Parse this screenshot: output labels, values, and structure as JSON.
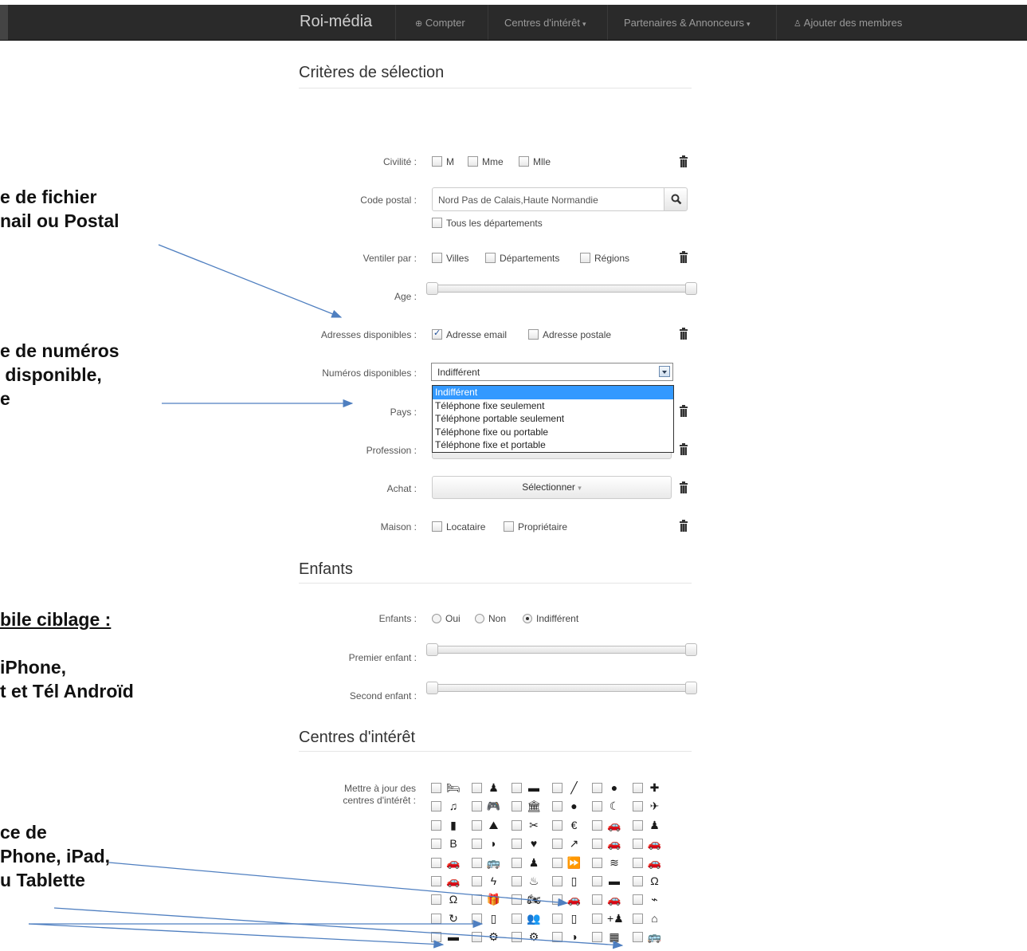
{
  "navbar": {
    "brand": "Roi-média",
    "items": [
      "Compter",
      "Centres d'intérêt",
      "Partenaires & Annonceurs",
      "Ajouter des membres"
    ]
  },
  "sections": {
    "criteria": "Critères de sélection",
    "children": "Enfants",
    "interests": "Centres d'intérêt"
  },
  "form": {
    "civilite": {
      "label": "Civilité :",
      "options": [
        "M",
        "Mme",
        "Mlle"
      ]
    },
    "code_postal": {
      "label": "Code postal :",
      "value": "Nord Pas de Calais,Haute Normandie",
      "all_label": "Tous les départements"
    },
    "ventiler": {
      "label": "Ventiler par :",
      "options": [
        "Villes",
        "Départements",
        "Régions"
      ]
    },
    "age": {
      "label": "Age :"
    },
    "adresses": {
      "label": "Adresses disponibles :",
      "options": [
        "Adresse email",
        "Adresse postale"
      ],
      "checked": [
        true,
        false
      ]
    },
    "numeros": {
      "label": "Numéros disponibles :",
      "value": "Indifférent",
      "options": [
        "Indifférent",
        "Téléphone fixe seulement",
        "Téléphone portable seulement",
        "Téléphone fixe ou portable",
        "Téléphone fixe et portable"
      ]
    },
    "pays": {
      "label": "Pays :"
    },
    "profession": {
      "label": "Profession :"
    },
    "achat": {
      "label": "Achat :",
      "button": "Sélectionner"
    },
    "maison": {
      "label": "Maison :",
      "options": [
        "Locataire",
        "Propriétaire"
      ]
    },
    "enfants": {
      "label": "Enfants :",
      "options": [
        "Oui",
        "Non",
        "Indifférent"
      ],
      "selected": "Indifférent"
    },
    "premier_enfant": {
      "label": "Premier enfant :"
    },
    "second_enfant": {
      "label": "Second enfant :"
    },
    "interets": {
      "label_line1": "Mettre à jour des",
      "label_line2": "centres d'intérêt :"
    }
  },
  "annotations": {
    "a1": [
      "e de fichier",
      "nail ou Postal"
    ],
    "a2": [
      "e de numéros",
      " disponible,",
      "e"
    ],
    "a3": [
      "bile ciblage :",
      "",
      "iPhone,",
      "t et Tél Androïd"
    ],
    "a4": [
      "ce de",
      "Phone, iPad,",
      "u Tablette"
    ]
  },
  "interest_icons": [
    [
      "bed-icon",
      "person-icon",
      "monitor-icon",
      "pencil-icon",
      "planet-icon",
      "medical-cross-icon"
    ],
    [
      "music-icon",
      "gamepad-icon",
      "bank-icon",
      "globe-icon",
      "moon-icon",
      "plane-icon"
    ],
    [
      "book-icon",
      "road-icon",
      "cutlery-icon",
      "euro-icon",
      "car-icon",
      "person-icon"
    ],
    [
      "blogger-icon",
      "binoculars-icon",
      "heart-icon",
      "chart-icon",
      "car-icon",
      "car-icon"
    ],
    [
      "car-icon",
      "bus-icon",
      "person-icon",
      "fast-forward-icon",
      "wifi-icon",
      "car-icon"
    ],
    [
      "car-icon",
      "bolt-icon",
      "cake-icon",
      "phone-icon",
      "tv-icon",
      "headphones-icon"
    ],
    [
      "headphones-icon",
      "gift-icon",
      "motorbike-icon",
      "car-icon",
      "car-icon",
      "antenna-icon"
    ],
    [
      "refresh-icon",
      "phone-icon",
      "users-icon",
      "phone-icon",
      "user-add-icon",
      "home-icon"
    ],
    [
      "monitor-icon",
      "cogs-icon",
      "cogs-icon",
      "pie-chart-icon",
      "calculator-icon",
      "bus-icon"
    ]
  ],
  "interest_glyphs": [
    [
      "🛏",
      "♟",
      "▬",
      "╱",
      "●",
      "✚"
    ],
    [
      "♫",
      "🎮",
      "🏛",
      "●",
      "☾",
      "✈"
    ],
    [
      "▮",
      "⛰",
      "✂",
      "€",
      "🚗",
      "♟"
    ],
    [
      "B",
      "◗",
      "♥",
      "↗",
      "🚗",
      "🚗"
    ],
    [
      "🚗",
      "🚌",
      "♟",
      "⏩",
      "≋",
      "🚗"
    ],
    [
      "🚗",
      "ϟ",
      "♨",
      "▯",
      "▬",
      "Ω"
    ],
    [
      "Ω",
      "🎁",
      "🏍",
      "🚗",
      "🚗",
      "⌁"
    ],
    [
      "↻",
      "▯",
      "👥",
      "▯",
      "+♟",
      "⌂"
    ],
    [
      "▬",
      "⚙",
      "⚙",
      "◑",
      "▦",
      "🚌"
    ]
  ]
}
